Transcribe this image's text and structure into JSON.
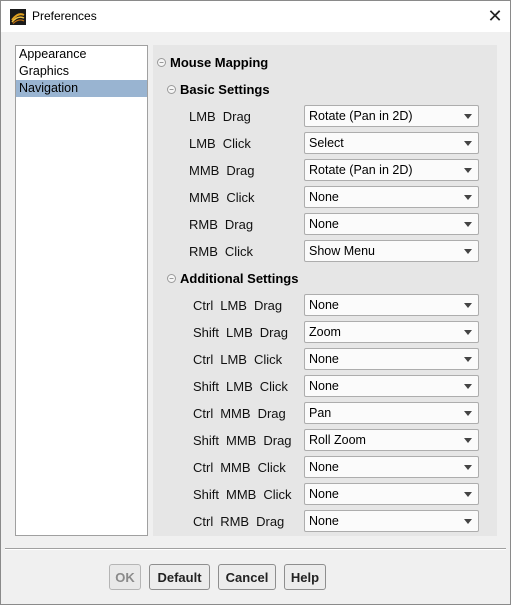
{
  "window": {
    "title": "Preferences"
  },
  "sidebar": {
    "items": [
      {
        "label": "Appearance",
        "selected": false
      },
      {
        "label": "Graphics",
        "selected": false
      },
      {
        "label": "Navigation",
        "selected": true
      }
    ]
  },
  "main": {
    "section_title": "Mouse Mapping",
    "basic": {
      "title": "Basic Settings",
      "rows": [
        {
          "mod": "",
          "button": "LMB",
          "action": "Drag",
          "value": "Rotate (Pan in 2D)"
        },
        {
          "mod": "",
          "button": "LMB",
          "action": "Click",
          "value": "Select"
        },
        {
          "mod": "",
          "button": "MMB",
          "action": "Drag",
          "value": "Rotate (Pan in 2D)"
        },
        {
          "mod": "",
          "button": "MMB",
          "action": "Click",
          "value": "None"
        },
        {
          "mod": "",
          "button": "RMB",
          "action": "Drag",
          "value": "None"
        },
        {
          "mod": "",
          "button": "RMB",
          "action": "Click",
          "value": "Show Menu"
        }
      ]
    },
    "additional": {
      "title": "Additional Settings",
      "rows": [
        {
          "mod": "Ctrl",
          "button": "LMB",
          "action": "Drag",
          "value": "None"
        },
        {
          "mod": "Shift",
          "button": "LMB",
          "action": "Drag",
          "value": "Zoom"
        },
        {
          "mod": "Ctrl",
          "button": "LMB",
          "action": "Click",
          "value": "None"
        },
        {
          "mod": "Shift",
          "button": "LMB",
          "action": "Click",
          "value": "None"
        },
        {
          "mod": "Ctrl",
          "button": "MMB",
          "action": "Drag",
          "value": "Pan"
        },
        {
          "mod": "Shift",
          "button": "MMB",
          "action": "Drag",
          "value": "Roll Zoom"
        },
        {
          "mod": "Ctrl",
          "button": "MMB",
          "action": "Click",
          "value": "None"
        },
        {
          "mod": "Shift",
          "button": "MMB",
          "action": "Click",
          "value": "None"
        },
        {
          "mod": "Ctrl",
          "button": "RMB",
          "action": "Drag",
          "value": "None"
        }
      ]
    }
  },
  "buttons": {
    "ok": "OK",
    "default": "Default",
    "cancel": "Cancel",
    "help": "Help",
    "ok_disabled": true
  },
  "icons": {
    "app": "fluent-app-icon",
    "close": "close-icon",
    "collapse": "collapse-icon",
    "dropdown": "chevron-down-icon"
  },
  "colors": {
    "selection": "#99b4d1",
    "panel_background": "#e6e6e6",
    "window_background": "#f0f0f0"
  }
}
